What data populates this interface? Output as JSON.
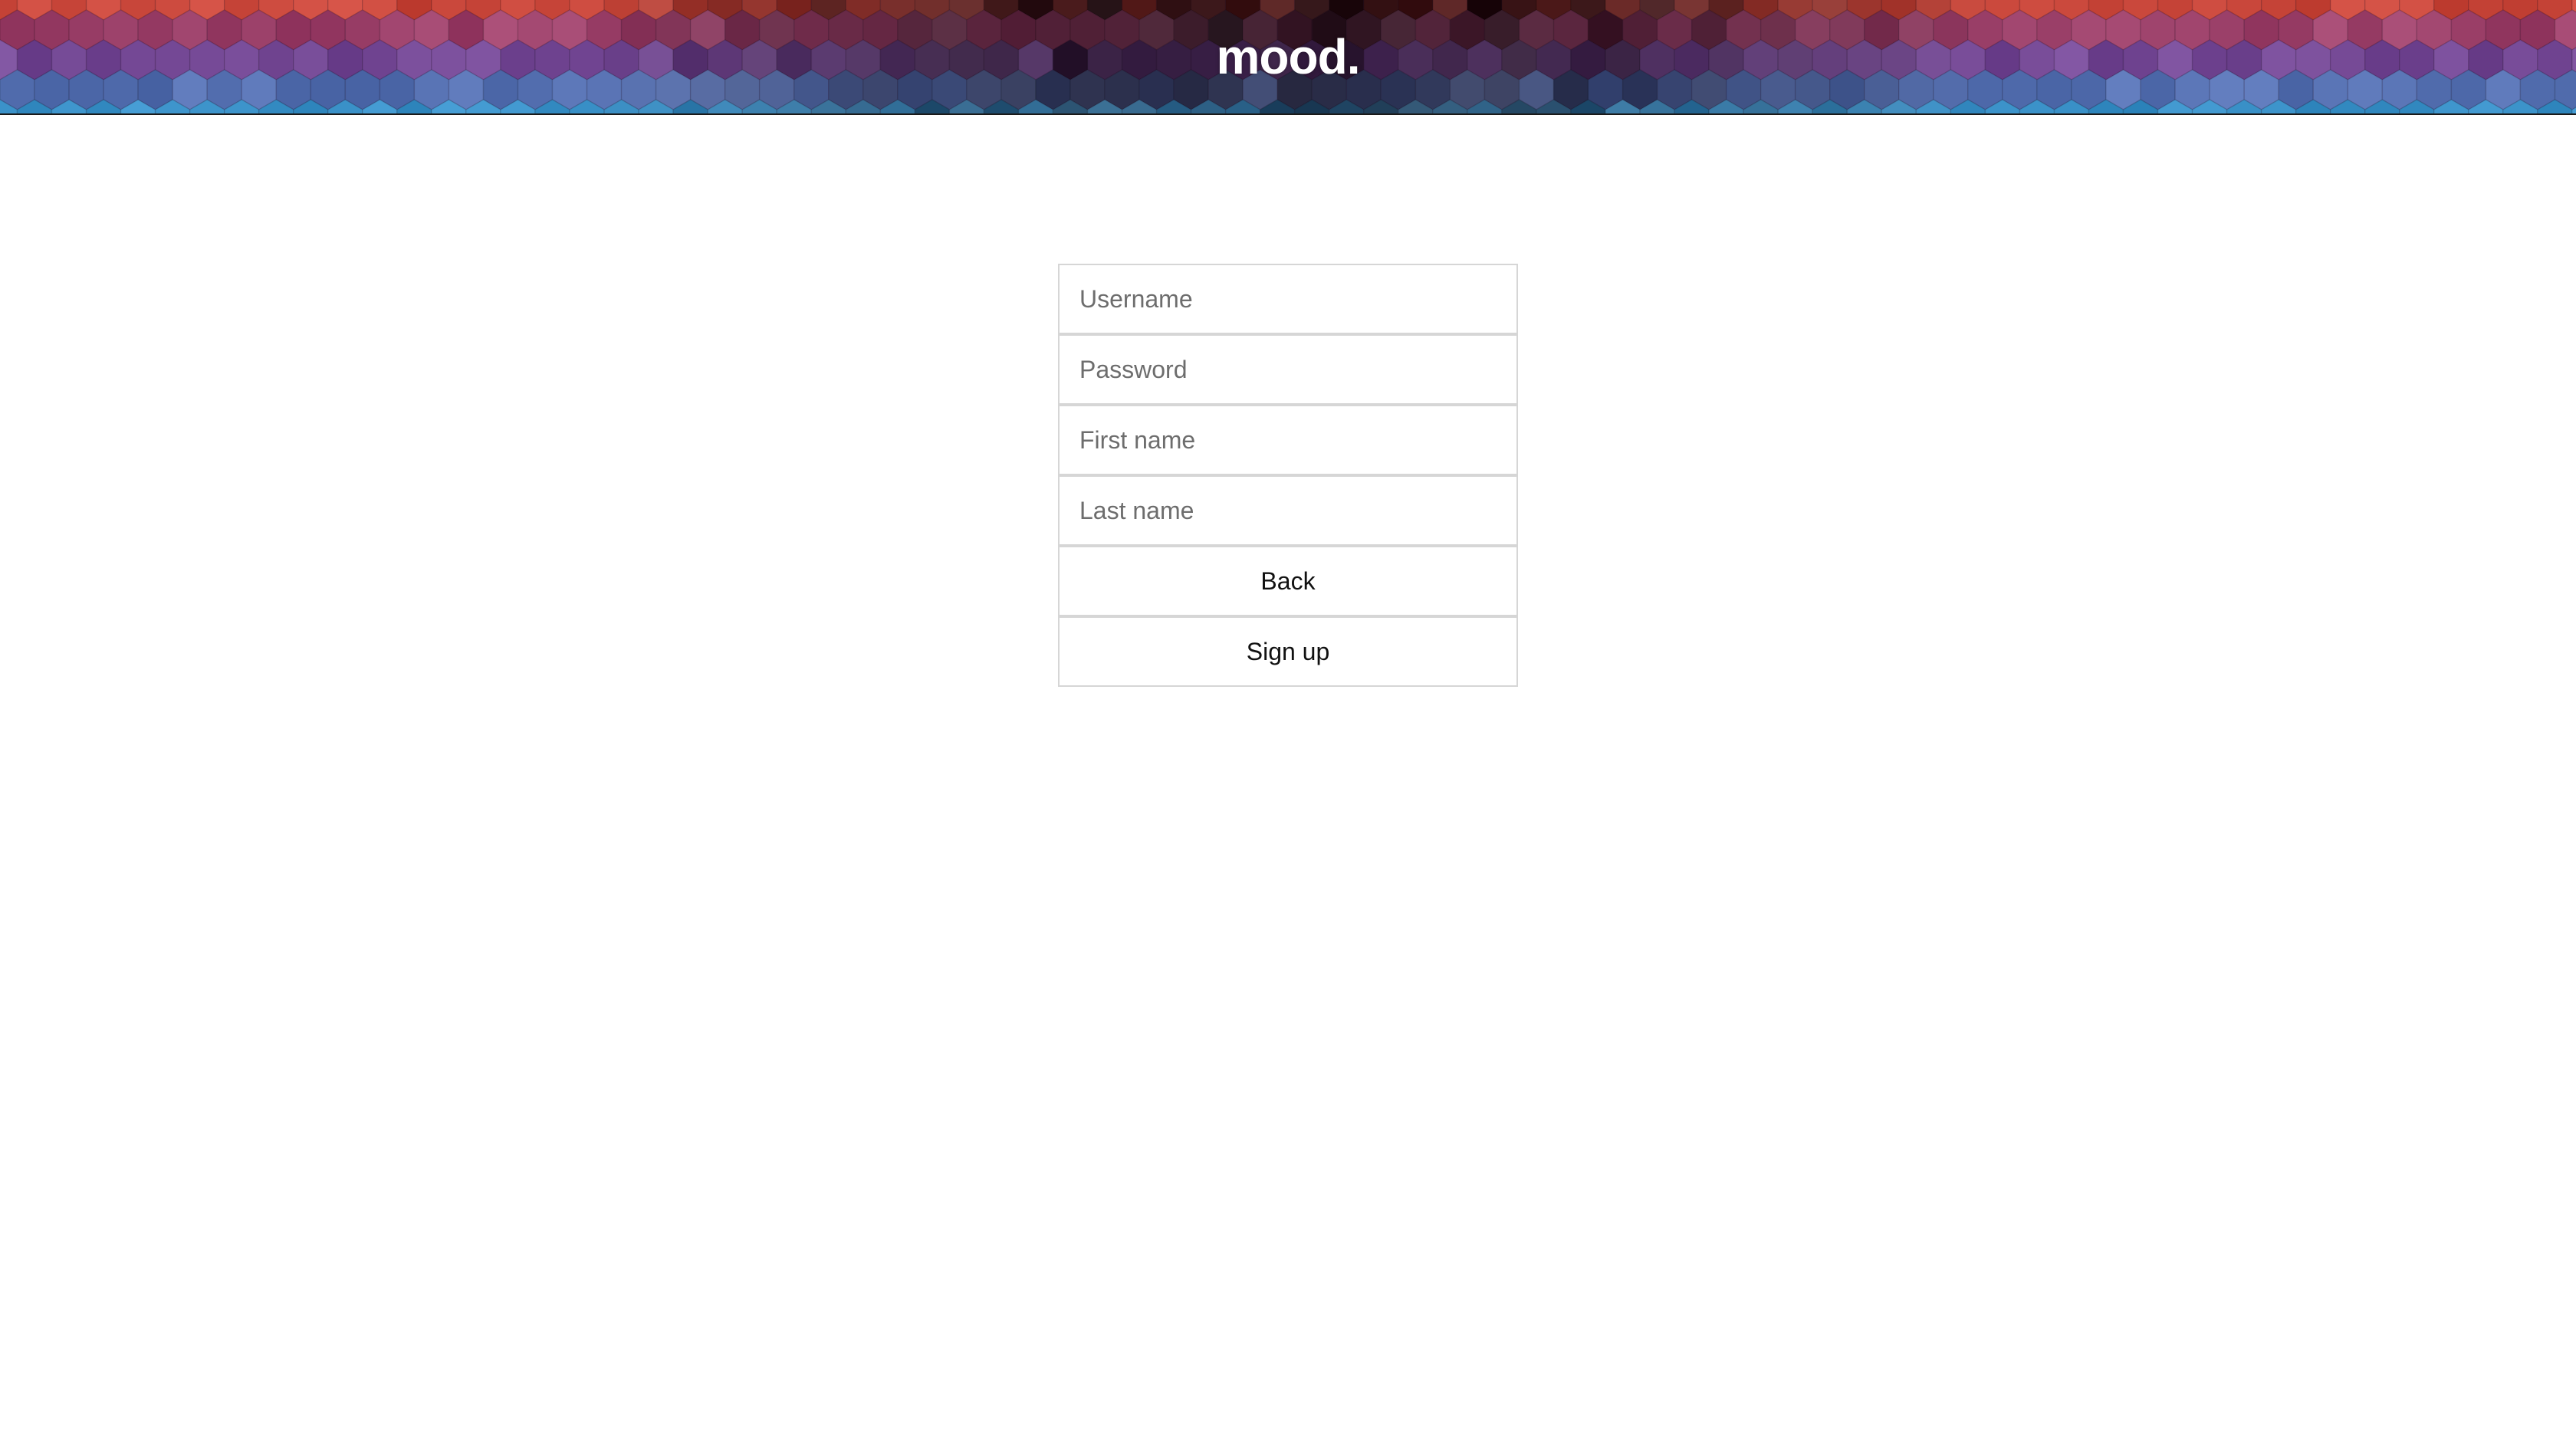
{
  "header": {
    "brand": "mood."
  },
  "form": {
    "username_placeholder": "Username",
    "username_value": "",
    "password_placeholder": "Password",
    "password_value": "",
    "first_name_placeholder": "First name",
    "first_name_value": "",
    "last_name_placeholder": "Last name",
    "last_name_value": "",
    "back_label": "Back",
    "signup_label": "Sign up"
  },
  "colors": {
    "hex_red": "#c8453a",
    "hex_purple": "#7b3f8f",
    "hex_blue": "#3a8fc8",
    "hex_dark": "#1a0f14"
  }
}
